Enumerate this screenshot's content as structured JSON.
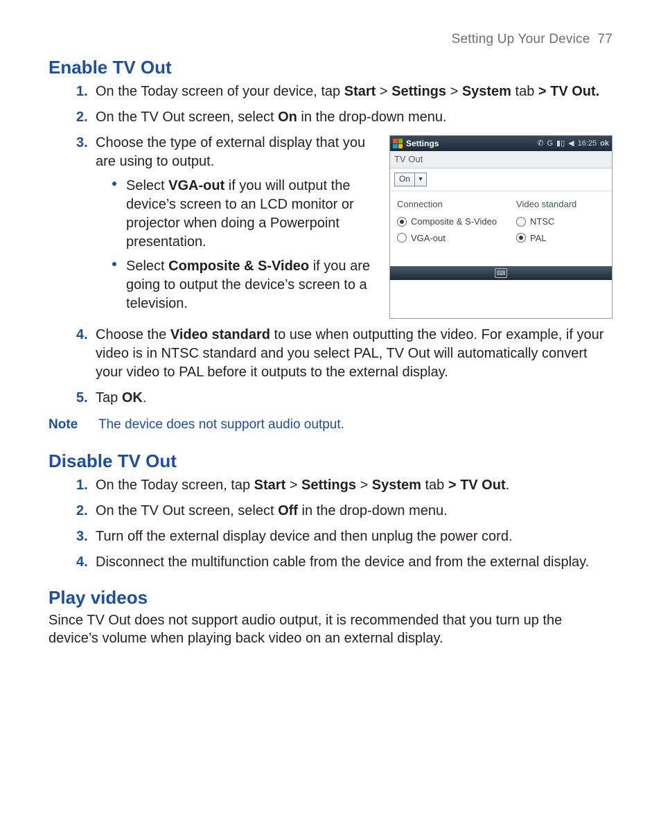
{
  "header": {
    "chapter": "Setting Up Your Device",
    "page": "77"
  },
  "sections": {
    "enable": {
      "title": "Enable TV Out",
      "items": [
        {
          "n": "1.",
          "pre": "On the Today screen of your device, tap ",
          "b1": "Start",
          "g1": " > ",
          "b2": "Settings",
          "g2": " > ",
          "b3": "System",
          "post1": " tab ",
          "b4": "> TV Out."
        },
        {
          "n": "2.",
          "pre": "On the TV Out screen, select ",
          "b1": "On",
          "post": " in the drop-down menu."
        },
        {
          "n": "3.",
          "text": "Choose the type of external display that you are using to output.",
          "bullets": [
            {
              "pre": "Select ",
              "b": "VGA-out",
              "post": " if you will output the device’s screen to an LCD monitor or projector when doing a Powerpoint presentation."
            },
            {
              "pre": "Select ",
              "b": "Composite & S-Video",
              "post": " if you are going to output the device’s screen to a television."
            }
          ]
        },
        {
          "n": "4.",
          "pre": "Choose the ",
          "b1": "Video standard",
          "post": " to use when outputting the video. For example, if your video is in NTSC standard and you select PAL, TV Out will automatically convert your video to PAL before it outputs to the external display."
        },
        {
          "n": "5.",
          "pre": "Tap ",
          "b1": "OK",
          "post": "."
        }
      ],
      "note": {
        "label": "Note",
        "text": "The device does not support audio output."
      }
    },
    "disable": {
      "title": "Disable TV Out",
      "items": [
        {
          "n": "1.",
          "pre": "On the Today screen, tap ",
          "b1": "Start",
          "g1": " > ",
          "b2": "Settings",
          "g2": " > ",
          "b3": "System",
          "post1": " tab ",
          "b4": "> TV Out",
          "post2": "."
        },
        {
          "n": "2.",
          "pre": "On the TV Out screen, select ",
          "b1": "Off",
          "post": " in the drop-down menu."
        },
        {
          "n": "3.",
          "text": "Turn off the external display device and then unplug the power cord."
        },
        {
          "n": "4.",
          "text": "Disconnect the multifunction cable from the device and from the external display."
        }
      ]
    },
    "play": {
      "title": "Play videos",
      "body": "Since TV Out does not support audio output, it is recommended that you turn up the device’s volume when playing back video on an external display."
    }
  },
  "screenshot": {
    "title": "Settings",
    "status_time": "16:25",
    "status_ok": "ok",
    "subhead": "TV Out",
    "dropdown_value": "On",
    "groups": {
      "connection": {
        "label": "Connection",
        "options": [
          {
            "label": "Composite & S-Video",
            "selected": true
          },
          {
            "label": "VGA-out",
            "selected": false
          }
        ]
      },
      "video_standard": {
        "label": "Video standard",
        "options": [
          {
            "label": "NTSC",
            "selected": false
          },
          {
            "label": "PAL",
            "selected": true
          }
        ]
      }
    }
  }
}
